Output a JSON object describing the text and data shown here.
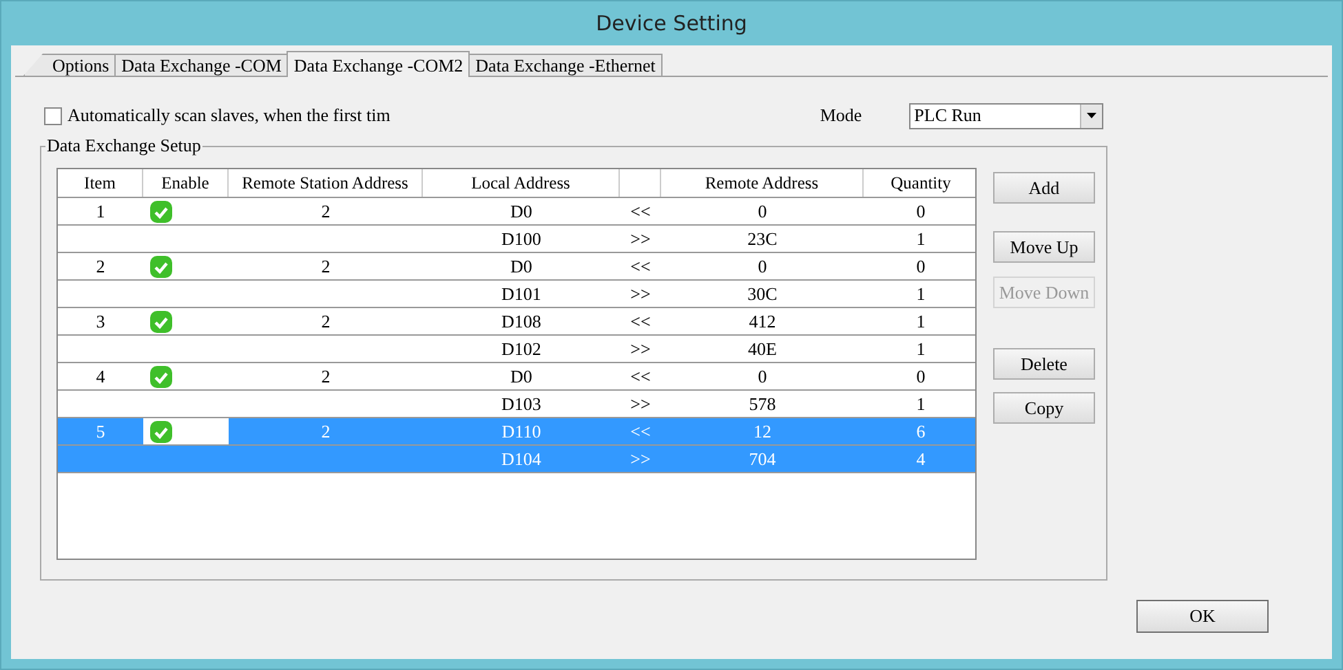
{
  "window": {
    "title": "Device Setting"
  },
  "tabs": [
    {
      "label": "Options",
      "selected": false
    },
    {
      "label": "Data Exchange -COM",
      "selected": false
    },
    {
      "label": "Data Exchange -COM2",
      "selected": true
    },
    {
      "label": "Data Exchange -Ethernet",
      "selected": false
    }
  ],
  "auto_scan": {
    "label": "Automatically scan slaves, when the first tim",
    "checked": false
  },
  "mode": {
    "label": "Mode",
    "value": "PLC Run"
  },
  "group": {
    "title": "Data Exchange Setup"
  },
  "table": {
    "columns": [
      "Item",
      "Enable",
      "Remote Station Address",
      "Local Address",
      "",
      "Remote Address",
      "Quantity"
    ],
    "rows": [
      {
        "item": "1",
        "enabled": true,
        "station": "2",
        "selected": false,
        "transfers": [
          {
            "local": "D0",
            "direction": "<<",
            "remote": "0",
            "quantity": "0"
          },
          {
            "local": "D100",
            "direction": ">>",
            "remote": "23C",
            "quantity": "1"
          }
        ]
      },
      {
        "item": "2",
        "enabled": true,
        "station": "2",
        "selected": false,
        "transfers": [
          {
            "local": "D0",
            "direction": "<<",
            "remote": "0",
            "quantity": "0"
          },
          {
            "local": "D101",
            "direction": ">>",
            "remote": "30C",
            "quantity": "1"
          }
        ]
      },
      {
        "item": "3",
        "enabled": true,
        "station": "2",
        "selected": false,
        "transfers": [
          {
            "local": "D108",
            "direction": "<<",
            "remote": "412",
            "quantity": "1"
          },
          {
            "local": "D102",
            "direction": ">>",
            "remote": "40E",
            "quantity": "1"
          }
        ]
      },
      {
        "item": "4",
        "enabled": true,
        "station": "2",
        "selected": false,
        "transfers": [
          {
            "local": "D0",
            "direction": "<<",
            "remote": "0",
            "quantity": "0"
          },
          {
            "local": "D103",
            "direction": ">>",
            "remote": "578",
            "quantity": "1"
          }
        ]
      },
      {
        "item": "5",
        "enabled": true,
        "station": "2",
        "selected": true,
        "transfers": [
          {
            "local": "D110",
            "direction": "<<",
            "remote": "12",
            "quantity": "6"
          },
          {
            "local": "D104",
            "direction": ">>",
            "remote": "704",
            "quantity": "4"
          }
        ]
      }
    ]
  },
  "side_buttons": [
    {
      "label": "Add",
      "disabled": false
    },
    {
      "label": "Move Up",
      "disabled": false
    },
    {
      "label": "Move Down",
      "disabled": true
    },
    {
      "label": "Delete",
      "disabled": false
    },
    {
      "label": "Copy",
      "disabled": false
    }
  ],
  "ok_button": {
    "label": "OK"
  }
}
